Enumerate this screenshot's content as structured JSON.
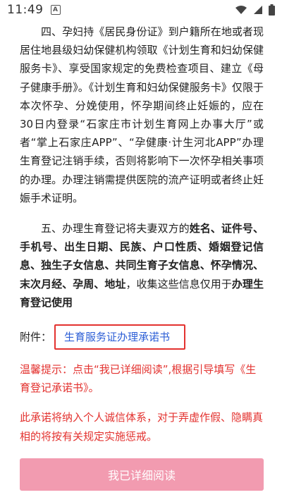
{
  "status": {
    "time": "11:49",
    "notif_icon": "A"
  },
  "content": {
    "para4": "四、孕妇持《居民身份证》到户籍所在地或者现居住地县级妇幼保健机构领取《计划生育和妇幼保健服务卡》、享受国家规定的免费检查项目、建立《母子健康手册》。《计划生育和妇幼保健服务卡》仅限于本次怀孕、分娩使用，怀孕期间终止妊娠的，应在30日内登录“石家庄市计划生育网上办事大厅”或者“掌上石家庄APP”、“孕健康·计生河北APP”办理生育登记注销手续，否则将影响下一次怀孕相关事项的办理。办理注销需提供医院的流产证明或者终止妊娠手术证明。",
    "para5_intro": "五、办理生育登记将夫妻双方的",
    "para5_fields": "姓名、证件号、手机号、出生日期、民族、户口性质、婚姻登记信息、独生子女信息、共同生育子女信息、怀孕情况、末次月经、孕周、地址",
    "para5_mid": "，收集这些信息仅用于",
    "para5_purpose": "办理生育登记使用",
    "attach_label": "附件：",
    "attach_link": "生育服务证办理承诺书",
    "tip": "温馨提示：点击“我已详细阅读”,根据引导填写《生育登记承诺书》。",
    "warning": "此承诺将纳入个人诚信体系，对于弄虚作假、隐瞒真相的将按有关规定实施惩戒。"
  },
  "button": {
    "label": "我已详细阅读"
  },
  "colors": {
    "accent_pink": "#f29bb0",
    "warning_red": "#e3322f",
    "link_blue": "#2d5fd6"
  }
}
